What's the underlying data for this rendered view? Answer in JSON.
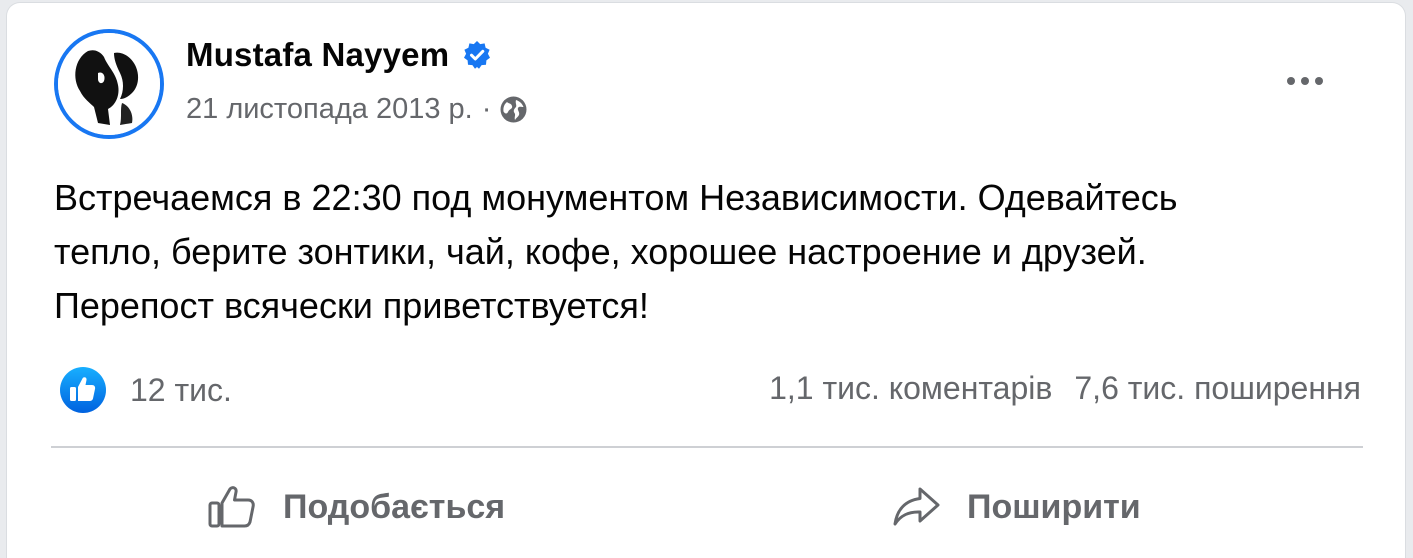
{
  "post": {
    "author": "Mustafa Nayyem",
    "date": "21 листопада 2013 р.",
    "separator": "·",
    "privacy_icon": "globe-icon",
    "verified_icon": "verified-badge-icon",
    "text": "Встречаемся в 22:30 под монументом Независимости. Одевайтесь\nтепло, берите зонтики, чай, кофе, хорошее настроение и друзей.\nПерепост всячески приветствуется!"
  },
  "stats": {
    "reaction_icon": "like-icon",
    "reactions": "12 тис.",
    "comments": "1,1 тис. коментарів",
    "shares": "7,6 тис. поширення"
  },
  "actions": {
    "like_label": "Подобається",
    "share_label": "Поширити"
  },
  "colors": {
    "accent": "#1877f2",
    "secondary_text": "#65676b",
    "primary_text": "#050505",
    "divider": "#ced0d4"
  }
}
